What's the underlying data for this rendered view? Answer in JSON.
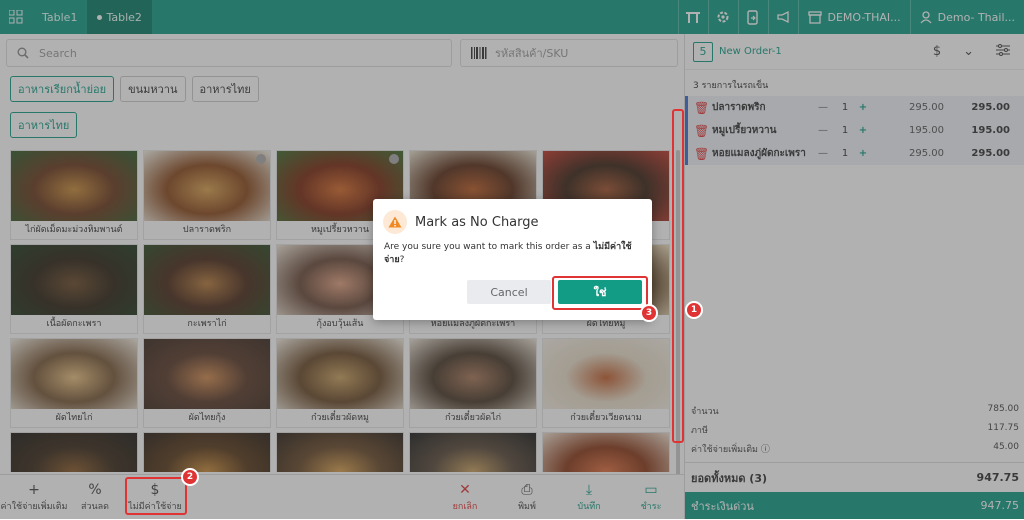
{
  "topbar": {
    "tabs": [
      {
        "label": "Table1"
      },
      {
        "label": "Table2"
      }
    ],
    "store_label": "DEMO-THAI...",
    "user_label": "Demo- Thail..."
  },
  "search": {
    "placeholder": "Search"
  },
  "sku": {
    "placeholder": "รหัสสินค้า/SKU"
  },
  "categories": [
    {
      "label": "อาหารเรียกน้ำย่อย"
    },
    {
      "label": "ขนมหวาน"
    },
    {
      "label": "อาหารไทย"
    }
  ],
  "category_row2": {
    "label": "อาหารไทย"
  },
  "products": [
    {
      "name": "ไก่ผัดเม็ดมะม่วงหิมพานต์",
      "checked": false
    },
    {
      "name": "ปลาราดพริก",
      "checked": true
    },
    {
      "name": "หมูเปรี้ยวหวาน",
      "checked": true
    },
    {
      "name": "",
      "checked": false
    },
    {
      "name": "",
      "checked": false
    },
    {
      "name": "เนื้อผัดกะเพรา",
      "checked": false
    },
    {
      "name": "กะเพราไก่",
      "checked": false
    },
    {
      "name": "กุ้งอบวุ้นเส้น",
      "checked": false
    },
    {
      "name": "หอยแมลงภู่ผัดกะเพรา",
      "checked": false
    },
    {
      "name": "ผัดไทยหมู",
      "checked": false
    },
    {
      "name": "ผัดไทยไก่",
      "checked": false
    },
    {
      "name": "ผัดไทยกุ้ง",
      "checked": false
    },
    {
      "name": "ก๋วยเตี๋ยวผัดหมู",
      "checked": false
    },
    {
      "name": "ก๋วยเตี๋ยวผัดไก่",
      "checked": false
    },
    {
      "name": "ก๋วยเตี๋ยวเวียดนาม",
      "checked": false
    },
    {
      "name": "",
      "checked": false
    },
    {
      "name": "",
      "checked": false
    },
    {
      "name": "",
      "checked": false
    },
    {
      "name": "",
      "checked": false
    },
    {
      "name": "",
      "checked": false
    }
  ],
  "bottom_actions": [
    {
      "label": "ค่าใช้จ่ายเพิ่มเติม",
      "icon": "+",
      "color": "#444"
    },
    {
      "label": "ส่วนลด",
      "icon": "%",
      "color": "#444"
    },
    {
      "label": "ไม่มีค่าใช้จ่าย",
      "icon": "$",
      "color": "#444"
    },
    {
      "label": "ยกเลิก",
      "icon": "✕",
      "color": "#e03434"
    },
    {
      "label": "พิมพ์",
      "icon": "⎙",
      "color": "#444"
    },
    {
      "label": "บันทึก",
      "icon": "⤓",
      "color": "#129c85"
    },
    {
      "label": "ชำระ",
      "icon": "▭",
      "color": "#129c85"
    }
  ],
  "order": {
    "number": "5",
    "title": "New Order-1",
    "items_count_label": "3 รายการในรถเข็น",
    "items": [
      {
        "name": "ปลาราดพริก",
        "qty": "1",
        "price": "295.00",
        "total": "295.00"
      },
      {
        "name": "หมูเปรี้ยวหวาน",
        "qty": "1",
        "price": "195.00",
        "total": "195.00"
      },
      {
        "name": "หอยแมลงภู่ผัดกะเพรา",
        "qty": "1",
        "price": "295.00",
        "total": "295.00"
      }
    ],
    "summary": {
      "amount_label": "จำนวน",
      "amount": "785.00",
      "tax_label": "ภาษี",
      "tax": "117.75",
      "extra_label": "ค่าใช้จ่ายเพิ่มเติม",
      "extra": "45.00"
    },
    "grand_label": "ยอดทั้งหมด  (3)",
    "grand_total": "947.75",
    "pay_label": "ชำระเงินด่วน",
    "pay_total": "947.75"
  },
  "modal": {
    "title": "Mark as No Charge",
    "body_prefix": "Are you sure you want to mark this order as a ",
    "body_bold": "ไม่มีค่าใช้จ่าย",
    "body_suffix": "?",
    "cancel_label": "Cancel",
    "confirm_label": "ใช่"
  },
  "annotations": [
    {
      "label": "1"
    },
    {
      "label": "2"
    },
    {
      "label": "3"
    }
  ],
  "colors": {
    "accent": "#129c85",
    "danger": "#e03434",
    "topbar": "#129c85"
  }
}
